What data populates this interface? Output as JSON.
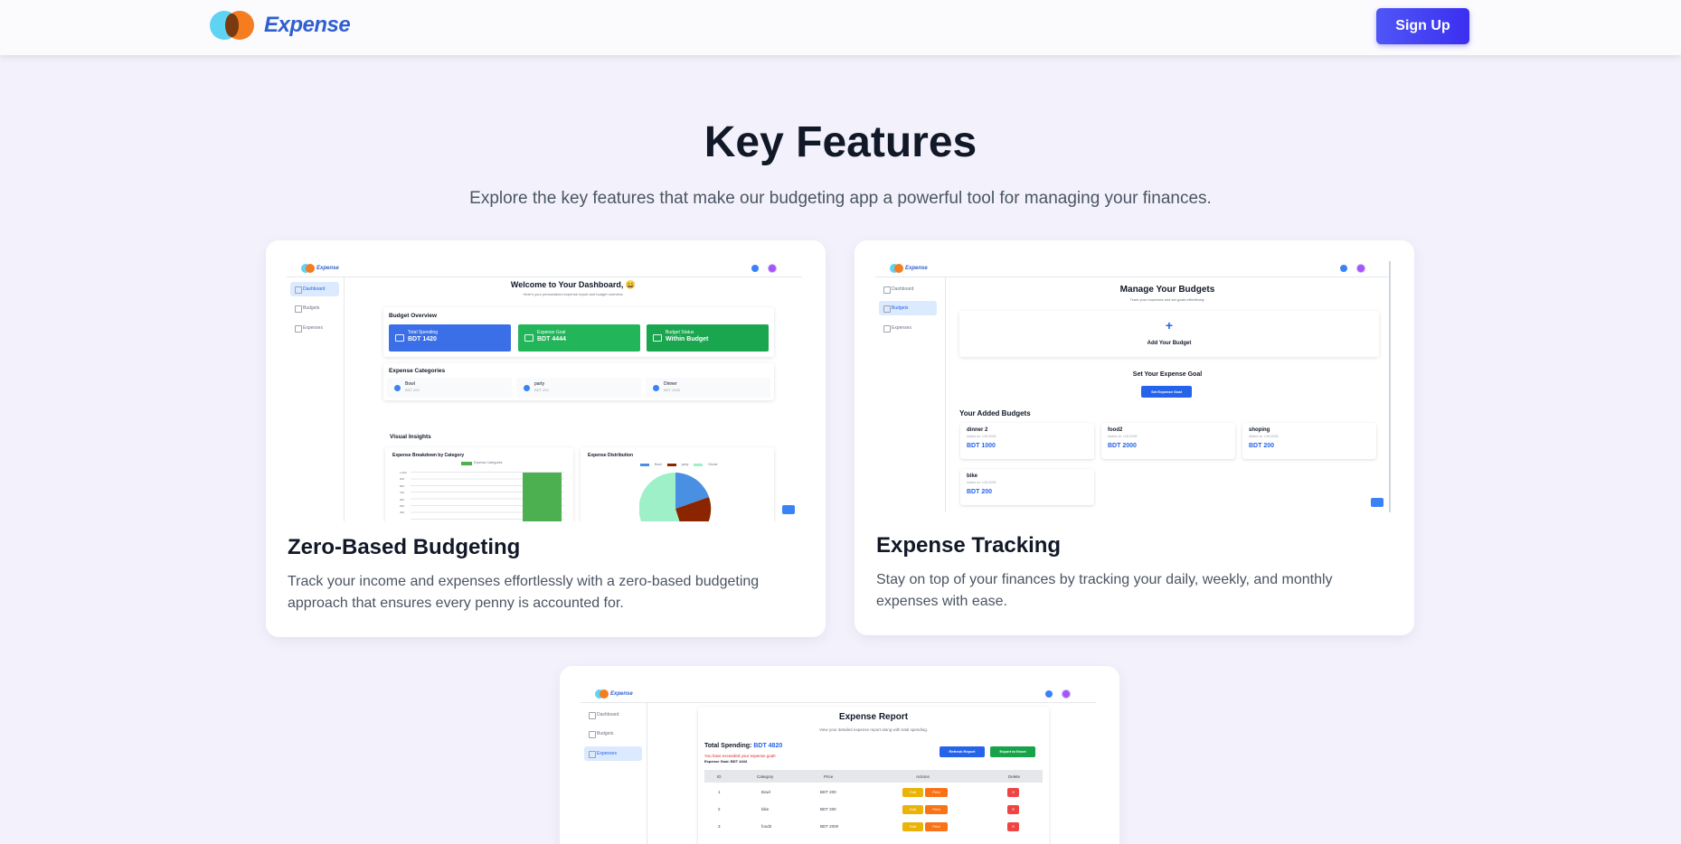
{
  "header": {
    "brand": "Expense",
    "signup_label": "Sign Up"
  },
  "hero": {
    "title": "Key Features",
    "subtitle": "Explore the key features that make our budgeting app a powerful tool for managing your finances."
  },
  "features": [
    {
      "title": "Zero-Based Budgeting",
      "description": "Track your income and expenses effortlessly with a zero-based budgeting approach that ensures every penny is accounted for."
    },
    {
      "title": "Expense Tracking",
      "description": "Stay on top of your finances by tracking your daily, weekly, and monthly expenses with ease."
    }
  ],
  "preview_common": {
    "brand": "Expense",
    "nav": [
      "Dashboard",
      "Budgets",
      "Expenses"
    ]
  },
  "dashboard_preview": {
    "title": "Welcome to Your Dashboard, 😄",
    "subtitle": "Here's your personalized expense report and budget overview.",
    "overview_title": "Budget Overview",
    "stats": [
      {
        "label": "Total Spending",
        "value": "BDT 1420",
        "color": "#3b6fe8"
      },
      {
        "label": "Expense Goal",
        "value": "BDT 4444",
        "color": "#22b55a"
      },
      {
        "label": "Budget Status",
        "value": "Within Budget",
        "color": "#1aa64f"
      }
    ],
    "categories_title": "Expense Categories",
    "categories": [
      {
        "name": "Bowl",
        "price": "BDT 200"
      },
      {
        "name": "party",
        "price": "BDT 200"
      },
      {
        "name": "Dinner",
        "price": "BDT 1000"
      }
    ],
    "insights_title": "Visual Insights",
    "bar_chart_title": "Expense Breakdown by Category",
    "bar_legend": "Expense Categories",
    "y_ticks": [
      "1,000",
      "900",
      "800",
      "700",
      "600",
      "500",
      "400"
    ],
    "pie_chart_title": "Expense Distribution",
    "pie_legend": [
      "Bowl",
      "party",
      "Dinner"
    ]
  },
  "budgets_preview": {
    "title": "Manage Your Budgets",
    "subtitle": "Track your expenses and set goals effortlessly.",
    "add_label": "Add Your Budget",
    "goal_title": "Set Your Expense Goal",
    "goal_button": "Set Expense Goal",
    "list_title": "Your Added Budgets",
    "budgets": [
      {
        "name": "dinner 2",
        "date": "Added on: 1/31/2025",
        "amount": "BDT 1000"
      },
      {
        "name": "food2",
        "date": "Added on: 1/31/2025",
        "amount": "BDT 2000"
      },
      {
        "name": "shoping",
        "date": "Added on: 1/31/2025",
        "amount": "BDT 200"
      },
      {
        "name": "bike",
        "date": "Added on: 1/31/2025",
        "amount": "BDT 200"
      }
    ]
  },
  "report_preview": {
    "title": "Expense Report",
    "subtitle": "View your detailed expense report along with total spending.",
    "total_label": "Total Spending:",
    "total_value": "BDT 4820",
    "warning": "You have exceeded your expense goal!",
    "goal": "Expense Goal: BDT 4444",
    "refresh_button": "Refresh Report",
    "export_button": "Export to Excel",
    "columns": [
      "ID",
      "Category",
      "Price",
      "Actions",
      "Delete"
    ],
    "rows": [
      {
        "id": "1",
        "category": "Bowl",
        "price": "BDT 200"
      },
      {
        "id": "2",
        "category": "bike",
        "price": "BDT 200"
      },
      {
        "id": "3",
        "category": "food2",
        "price": "BDT 2000"
      }
    ],
    "edit_label": "Edit",
    "pdf_label": "Print"
  },
  "colors": {
    "brand_blue": "#2f5fd0",
    "signup_gradient": [
      "#4f56f7",
      "#3b2ff0"
    ],
    "page_bg": "#f3f2fc",
    "accent_green": "#22b55a"
  }
}
